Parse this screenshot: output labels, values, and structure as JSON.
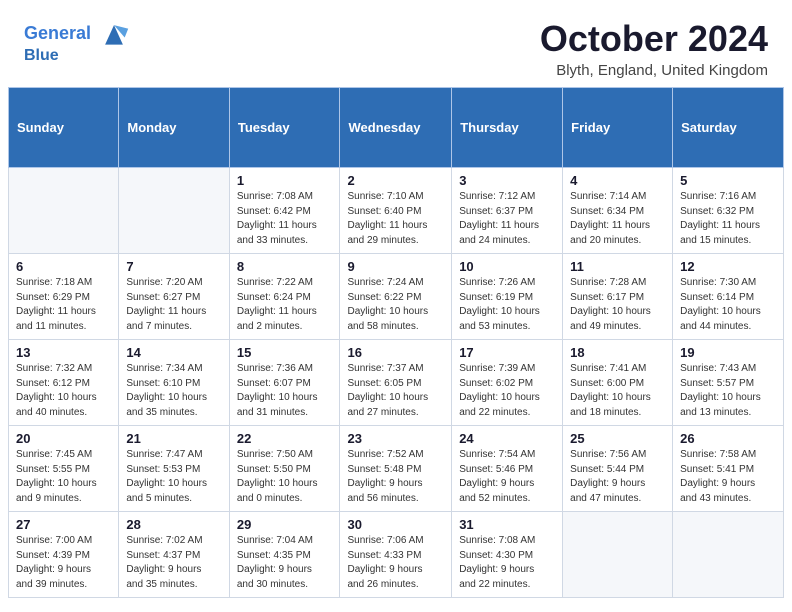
{
  "header": {
    "logo_line1": "General",
    "logo_line2": "Blue",
    "month_title": "October 2024",
    "location": "Blyth, England, United Kingdom"
  },
  "days_of_week": [
    "Sunday",
    "Monday",
    "Tuesday",
    "Wednesday",
    "Thursday",
    "Friday",
    "Saturday"
  ],
  "weeks": [
    [
      {
        "day": "",
        "info": ""
      },
      {
        "day": "",
        "info": ""
      },
      {
        "day": "1",
        "info": "Sunrise: 7:08 AM\nSunset: 6:42 PM\nDaylight: 11 hours\nand 33 minutes."
      },
      {
        "day": "2",
        "info": "Sunrise: 7:10 AM\nSunset: 6:40 PM\nDaylight: 11 hours\nand 29 minutes."
      },
      {
        "day": "3",
        "info": "Sunrise: 7:12 AM\nSunset: 6:37 PM\nDaylight: 11 hours\nand 24 minutes."
      },
      {
        "day": "4",
        "info": "Sunrise: 7:14 AM\nSunset: 6:34 PM\nDaylight: 11 hours\nand 20 minutes."
      },
      {
        "day": "5",
        "info": "Sunrise: 7:16 AM\nSunset: 6:32 PM\nDaylight: 11 hours\nand 15 minutes."
      }
    ],
    [
      {
        "day": "6",
        "info": "Sunrise: 7:18 AM\nSunset: 6:29 PM\nDaylight: 11 hours\nand 11 minutes."
      },
      {
        "day": "7",
        "info": "Sunrise: 7:20 AM\nSunset: 6:27 PM\nDaylight: 11 hours\nand 7 minutes."
      },
      {
        "day": "8",
        "info": "Sunrise: 7:22 AM\nSunset: 6:24 PM\nDaylight: 11 hours\nand 2 minutes."
      },
      {
        "day": "9",
        "info": "Sunrise: 7:24 AM\nSunset: 6:22 PM\nDaylight: 10 hours\nand 58 minutes."
      },
      {
        "day": "10",
        "info": "Sunrise: 7:26 AM\nSunset: 6:19 PM\nDaylight: 10 hours\nand 53 minutes."
      },
      {
        "day": "11",
        "info": "Sunrise: 7:28 AM\nSunset: 6:17 PM\nDaylight: 10 hours\nand 49 minutes."
      },
      {
        "day": "12",
        "info": "Sunrise: 7:30 AM\nSunset: 6:14 PM\nDaylight: 10 hours\nand 44 minutes."
      }
    ],
    [
      {
        "day": "13",
        "info": "Sunrise: 7:32 AM\nSunset: 6:12 PM\nDaylight: 10 hours\nand 40 minutes."
      },
      {
        "day": "14",
        "info": "Sunrise: 7:34 AM\nSunset: 6:10 PM\nDaylight: 10 hours\nand 35 minutes."
      },
      {
        "day": "15",
        "info": "Sunrise: 7:36 AM\nSunset: 6:07 PM\nDaylight: 10 hours\nand 31 minutes."
      },
      {
        "day": "16",
        "info": "Sunrise: 7:37 AM\nSunset: 6:05 PM\nDaylight: 10 hours\nand 27 minutes."
      },
      {
        "day": "17",
        "info": "Sunrise: 7:39 AM\nSunset: 6:02 PM\nDaylight: 10 hours\nand 22 minutes."
      },
      {
        "day": "18",
        "info": "Sunrise: 7:41 AM\nSunset: 6:00 PM\nDaylight: 10 hours\nand 18 minutes."
      },
      {
        "day": "19",
        "info": "Sunrise: 7:43 AM\nSunset: 5:57 PM\nDaylight: 10 hours\nand 13 minutes."
      }
    ],
    [
      {
        "day": "20",
        "info": "Sunrise: 7:45 AM\nSunset: 5:55 PM\nDaylight: 10 hours\nand 9 minutes."
      },
      {
        "day": "21",
        "info": "Sunrise: 7:47 AM\nSunset: 5:53 PM\nDaylight: 10 hours\nand 5 minutes."
      },
      {
        "day": "22",
        "info": "Sunrise: 7:50 AM\nSunset: 5:50 PM\nDaylight: 10 hours\nand 0 minutes."
      },
      {
        "day": "23",
        "info": "Sunrise: 7:52 AM\nSunset: 5:48 PM\nDaylight: 9 hours\nand 56 minutes."
      },
      {
        "day": "24",
        "info": "Sunrise: 7:54 AM\nSunset: 5:46 PM\nDaylight: 9 hours\nand 52 minutes."
      },
      {
        "day": "25",
        "info": "Sunrise: 7:56 AM\nSunset: 5:44 PM\nDaylight: 9 hours\nand 47 minutes."
      },
      {
        "day": "26",
        "info": "Sunrise: 7:58 AM\nSunset: 5:41 PM\nDaylight: 9 hours\nand 43 minutes."
      }
    ],
    [
      {
        "day": "27",
        "info": "Sunrise: 7:00 AM\nSunset: 4:39 PM\nDaylight: 9 hours\nand 39 minutes."
      },
      {
        "day": "28",
        "info": "Sunrise: 7:02 AM\nSunset: 4:37 PM\nDaylight: 9 hours\nand 35 minutes."
      },
      {
        "day": "29",
        "info": "Sunrise: 7:04 AM\nSunset: 4:35 PM\nDaylight: 9 hours\nand 30 minutes."
      },
      {
        "day": "30",
        "info": "Sunrise: 7:06 AM\nSunset: 4:33 PM\nDaylight: 9 hours\nand 26 minutes."
      },
      {
        "day": "31",
        "info": "Sunrise: 7:08 AM\nSunset: 4:30 PM\nDaylight: 9 hours\nand 22 minutes."
      },
      {
        "day": "",
        "info": ""
      },
      {
        "day": "",
        "info": ""
      }
    ]
  ]
}
